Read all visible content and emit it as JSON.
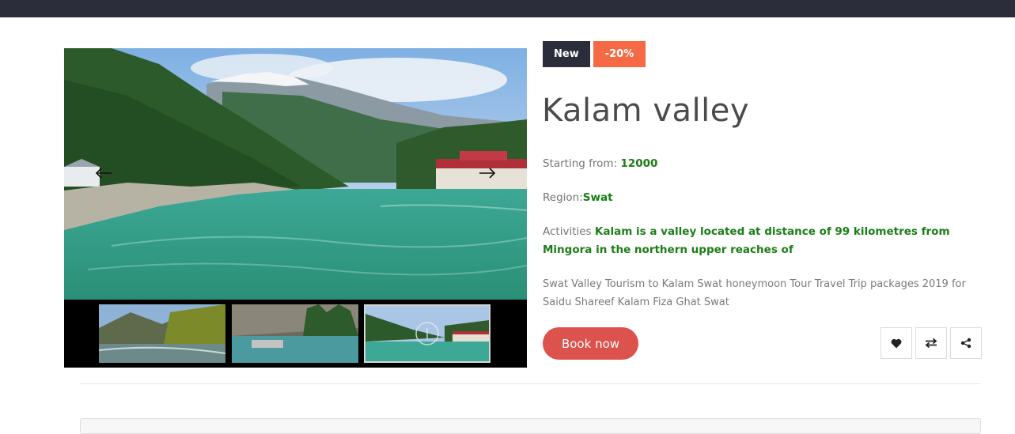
{
  "badges": {
    "new": "New",
    "sale": "-20%"
  },
  "tour": {
    "title": "Kalam valley",
    "price_label": "Starting from: ",
    "price_value": "12000",
    "region_label": "Region:",
    "region_value": "Swat",
    "activities_label": "Activities ",
    "activities_value": "Kalam is a valley located at distance of 99 kilometres from Mingora in the northern upper reaches of",
    "description": "Swat Valley Tourism to Kalam Swat honeymoon Tour Travel Trip packages 2019 for Saidu Shareef Kalam Fiza Ghat Swat"
  },
  "actions": {
    "book_label": "Book now",
    "wishlist_icon": "heart-icon",
    "compare_icon": "compare-arrows-icon",
    "share_icon": "share-icon"
  },
  "gallery": {
    "prev_icon": "arrow-left-icon",
    "next_icon": "arrow-right-icon",
    "thumb_count": 3,
    "active_thumb": 3
  },
  "colors": {
    "topbar": "#2b2d3b",
    "badge_new": "#2b2d3b",
    "badge_sale": "#f56a44",
    "book_button": "#dc524c",
    "value_green": "#1a7e16"
  }
}
